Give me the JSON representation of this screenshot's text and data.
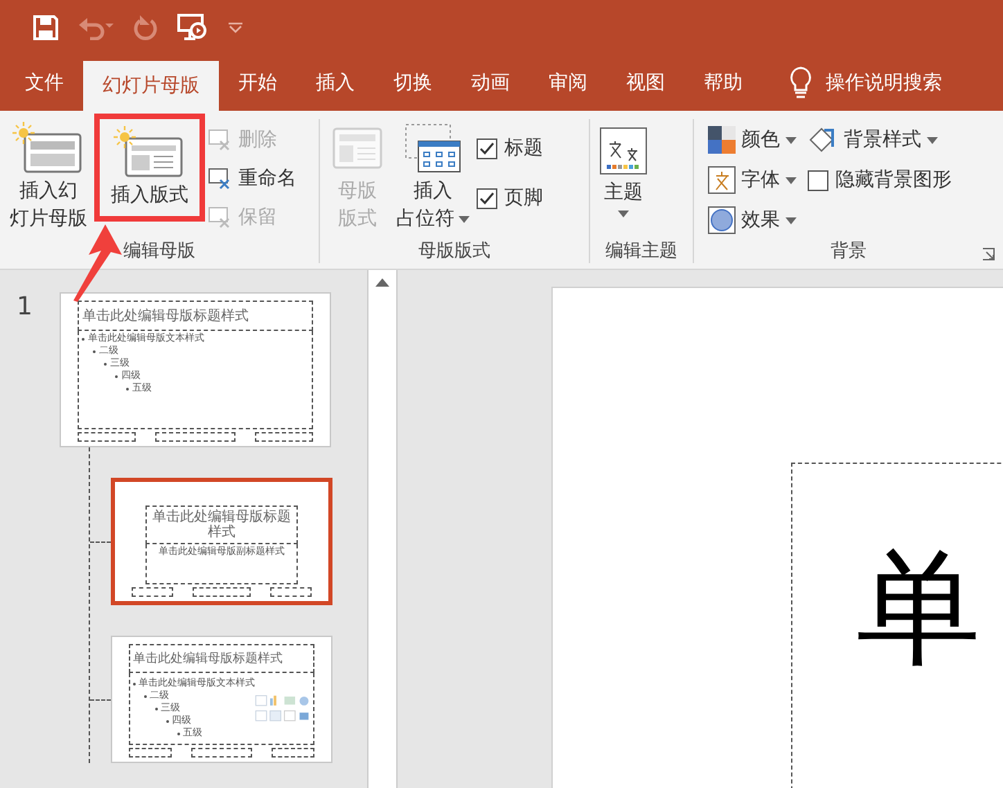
{
  "tabs": [
    {
      "label": "文件",
      "selected": false
    },
    {
      "label": "幻灯片母版",
      "selected": true
    },
    {
      "label": "开始",
      "selected": false
    },
    {
      "label": "插入",
      "selected": false
    },
    {
      "label": "切换",
      "selected": false
    },
    {
      "label": "动画",
      "selected": false
    },
    {
      "label": "审阅",
      "selected": false
    },
    {
      "label": "视图",
      "selected": false
    },
    {
      "label": "帮助",
      "selected": false
    }
  ],
  "tell_me": "操作说明搜索",
  "ribbon": {
    "edit_master": {
      "label": "编辑母版",
      "large_buttons": [
        {
          "lines": [
            "插入幻",
            "灯片母版"
          ],
          "highlighted": false
        },
        {
          "lines": [
            "插入版式"
          ],
          "highlighted": true
        }
      ],
      "small_buttons": [
        {
          "label": "删除",
          "disabled": true
        },
        {
          "label": "重命名",
          "disabled": false
        },
        {
          "label": "保留",
          "disabled": true
        }
      ]
    },
    "master_layout": {
      "label": "母版版式",
      "master_layout_button": {
        "lines": [
          "母版",
          "版式"
        ],
        "disabled": true
      },
      "insert_placeholder_button": {
        "lines": [
          "插入",
          "占位符"
        ]
      },
      "checkboxes": [
        {
          "label": "标题",
          "checked": true
        },
        {
          "label": "页脚",
          "checked": true
        }
      ]
    },
    "edit_theme": {
      "label": "编辑主题",
      "theme_button": "主题"
    },
    "background": {
      "label": "背景",
      "theme_options": [
        {
          "kind": "colors",
          "label": "颜色"
        },
        {
          "kind": "fonts",
          "label": "字体"
        },
        {
          "kind": "effects",
          "label": "效果"
        }
      ],
      "background_styles": "背景样式",
      "hide_background_graphics": {
        "label": "隐藏背景图形",
        "checked": false
      }
    }
  },
  "thumbnails": {
    "slide_number": "1",
    "items": [
      {
        "kind": "master",
        "selected": false,
        "title": "单击此处编辑母版标题样式",
        "body": [
          "单击此处编辑母版文本样式",
          "二级",
          "三级",
          "四级",
          "五级"
        ]
      },
      {
        "kind": "title_slide",
        "selected": true,
        "title": "单击此处编辑母版标题样式",
        "subtitle": "单击此处编辑母版副标题样式"
      },
      {
        "kind": "title_content",
        "selected": false,
        "title": "单击此处编辑母版标题样式",
        "body": [
          "单击此处编辑母版文本样式",
          "二级",
          "三级",
          "四级",
          "五级"
        ]
      }
    ]
  },
  "canvas": {
    "title_text": "单"
  }
}
